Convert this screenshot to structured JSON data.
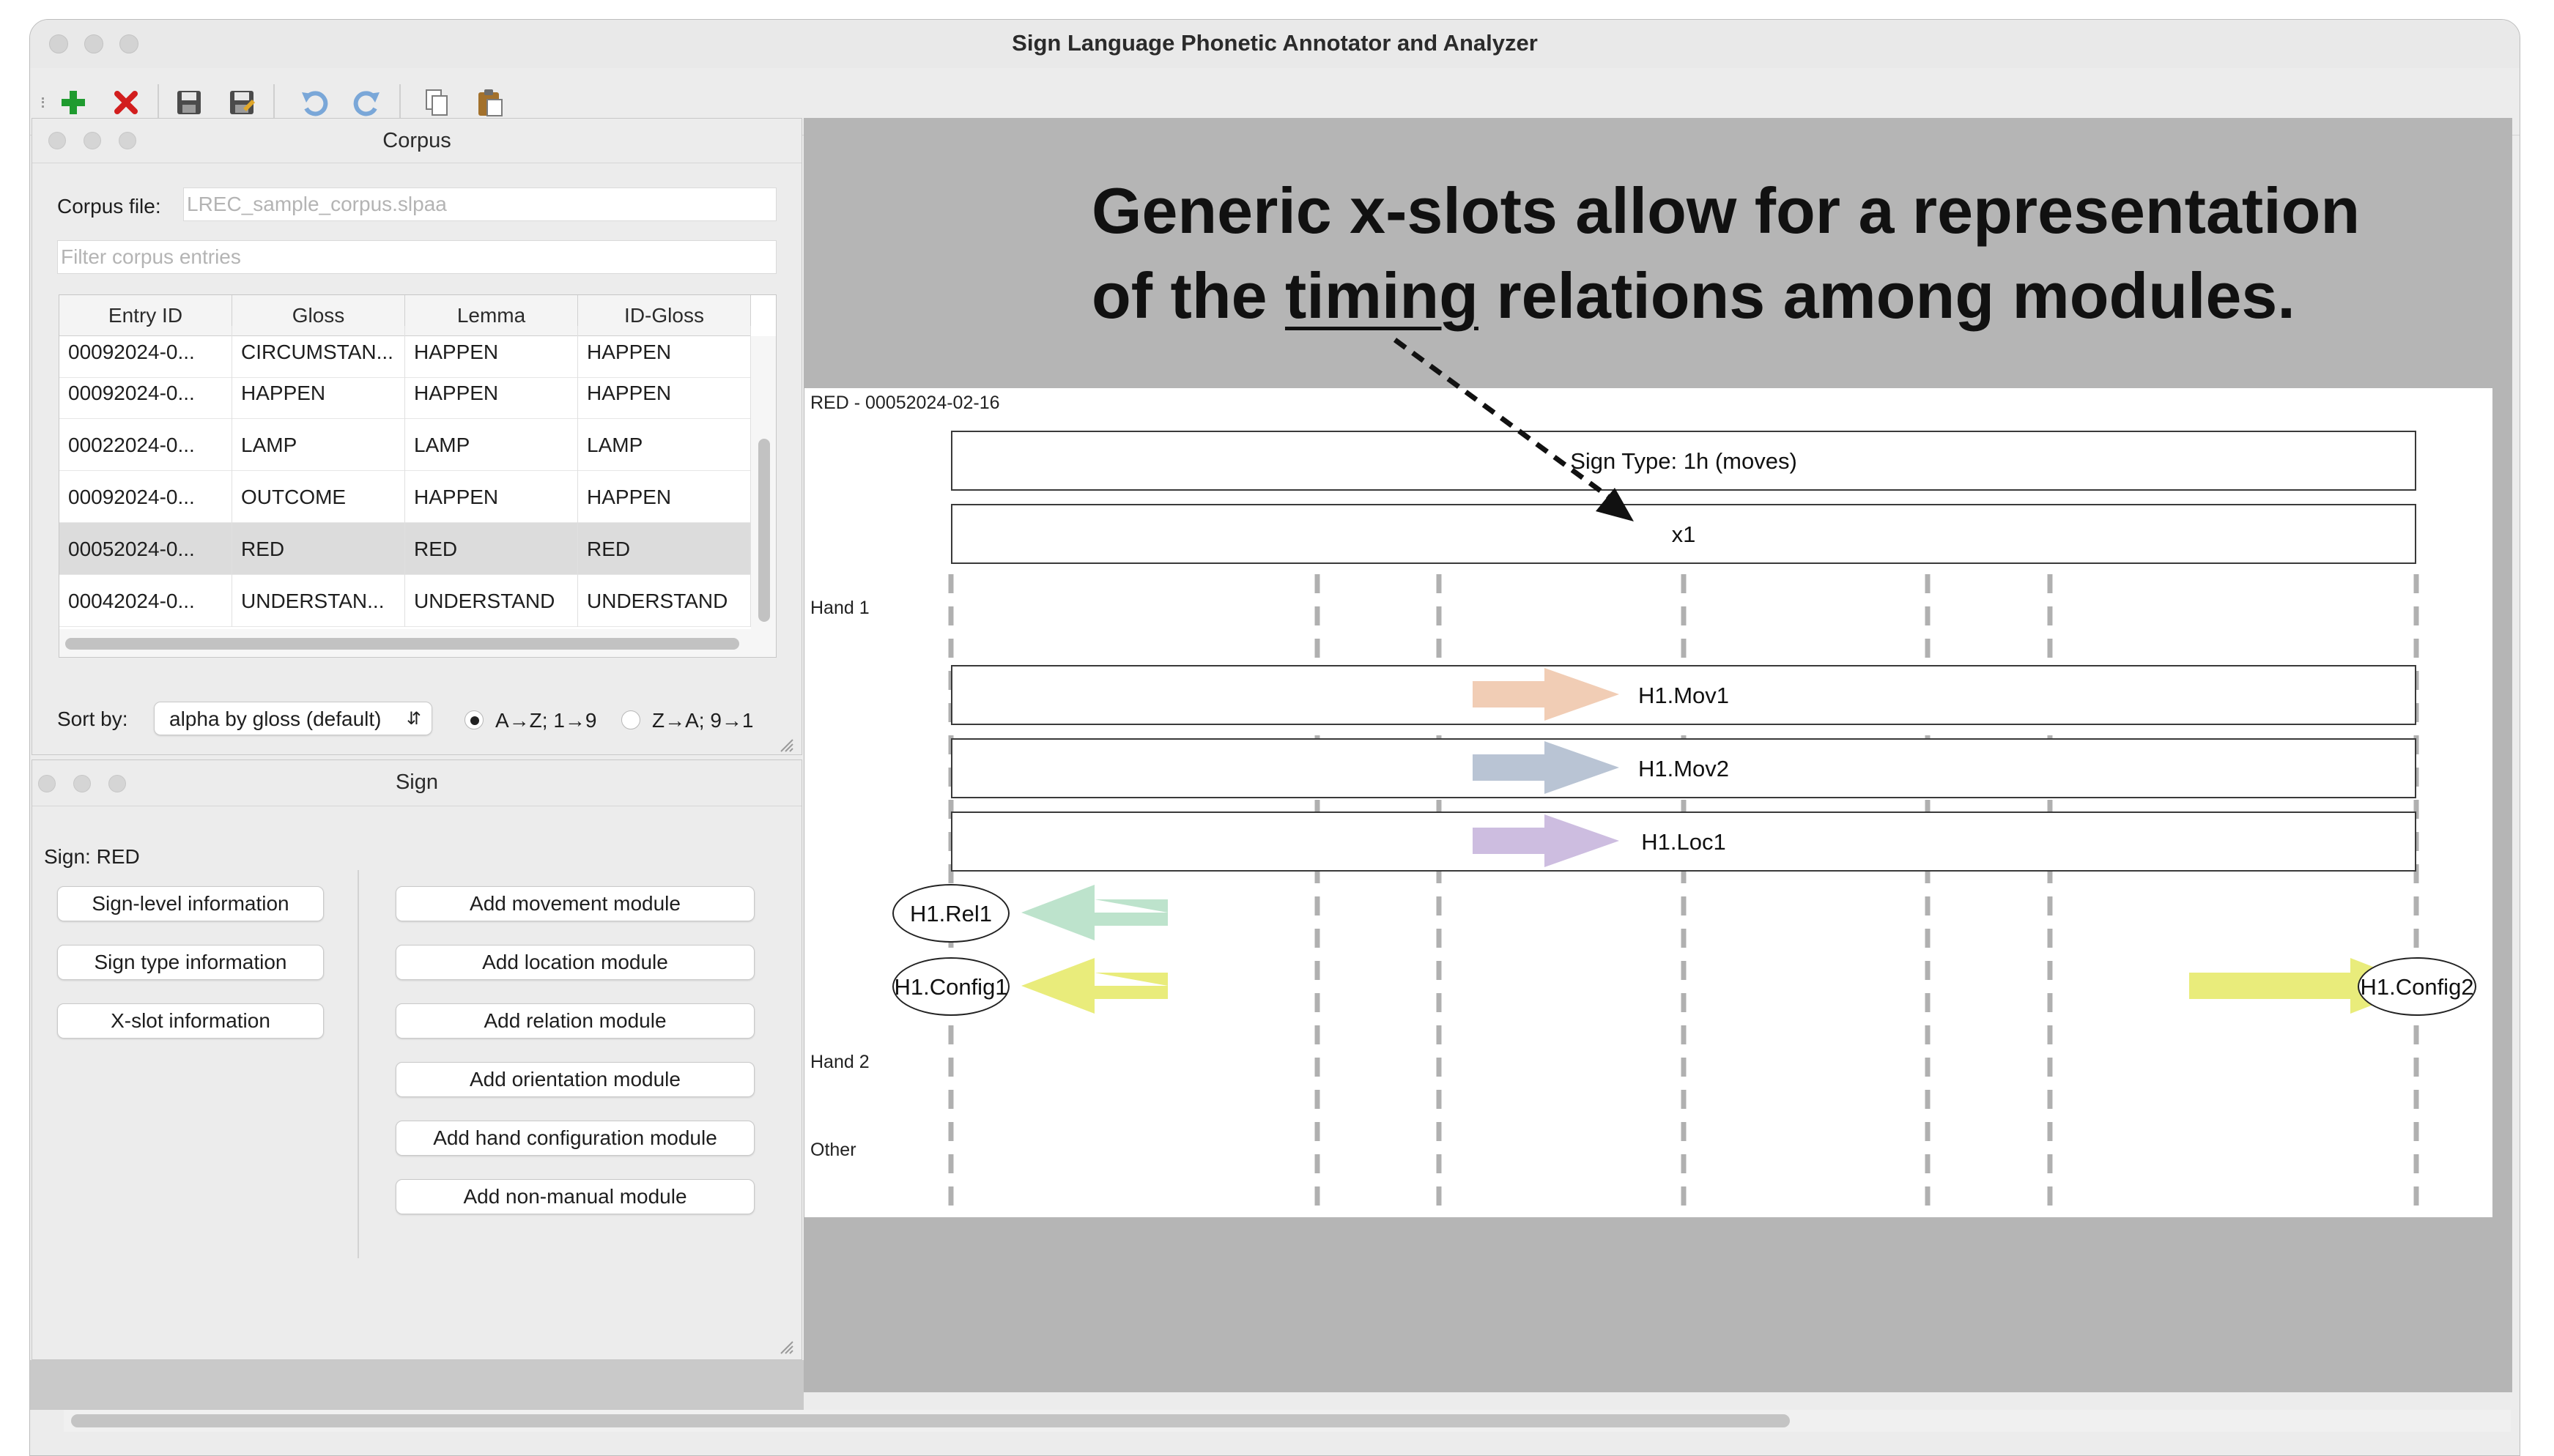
{
  "window": {
    "title": "Sign Language Phonetic Annotator and Analyzer"
  },
  "toolbar": {
    "icons": [
      "add-icon",
      "delete-icon",
      "save-icon",
      "save-as-icon",
      "undo-icon",
      "redo-icon",
      "copy-icon",
      "paste-icon"
    ]
  },
  "corpus_panel": {
    "title": "Corpus",
    "corpus_file_label": "Corpus file:",
    "corpus_file_value": "LREC_sample_corpus.slpaa",
    "filter_placeholder": "Filter corpus entries",
    "columns": [
      "Entry ID",
      "Gloss",
      "Lemma",
      "ID-Gloss"
    ],
    "rows": [
      [
        "00092024-0...",
        "CIRCUMSTAN...",
        "HAPPEN",
        "HAPPEN"
      ],
      [
        "00092024-0...",
        "HAPPEN",
        "HAPPEN",
        "HAPPEN"
      ],
      [
        "00022024-0...",
        "LAMP",
        "LAMP",
        "LAMP"
      ],
      [
        "00092024-0...",
        "OUTCOME",
        "HAPPEN",
        "HAPPEN"
      ],
      [
        "00052024-0...",
        "RED",
        "RED",
        "RED"
      ],
      [
        "00042024-0...",
        "UNDERSTAN...",
        "UNDERSTAND",
        "UNDERSTAND"
      ]
    ],
    "selected_row": 4,
    "sort_label": "Sort by:",
    "sort_value": "alpha by gloss (default)",
    "sort_asc_label": "A→Z; 1→9",
    "sort_desc_label": "Z→A; 9→1",
    "sort_asc_checked": true
  },
  "sign_panel": {
    "title": "Sign",
    "sign_label": "Sign: RED",
    "info_buttons": [
      "Sign-level information",
      "Sign type information",
      "X-slot information"
    ],
    "module_buttons": [
      "Add movement module",
      "Add location module",
      "Add relation module",
      "Add orientation module",
      "Add hand configuration module",
      "Add non-manual module"
    ]
  },
  "annotation": {
    "line1": "Generic x-slots allow for a representation",
    "line2_before": "of the ",
    "line2_underlined": "timing",
    "line2_after": " relations among modules."
  },
  "timeline": {
    "header": "RED - 00052024-02-16",
    "sign_type": "Sign Type: 1h (moves)",
    "xslot": "x1",
    "row_labels": {
      "hand1": "Hand 1",
      "hand2": "Hand 2",
      "other": "Other"
    },
    "modules": {
      "mov1": "H1.Mov1",
      "mov2": "H1.Mov2",
      "loc1": "H1.Loc1",
      "rel1": "H1.Rel1",
      "config1": "H1.Config1",
      "config2": "H1.Config2"
    },
    "colors": {
      "mov1_arrow": "#f1cdb5",
      "mov2_arrow": "#b9c4d4",
      "loc1_arrow": "#cdbde0",
      "rel1_arrow": "#bde3cc",
      "config_arrow": "#e9ec7b"
    }
  }
}
